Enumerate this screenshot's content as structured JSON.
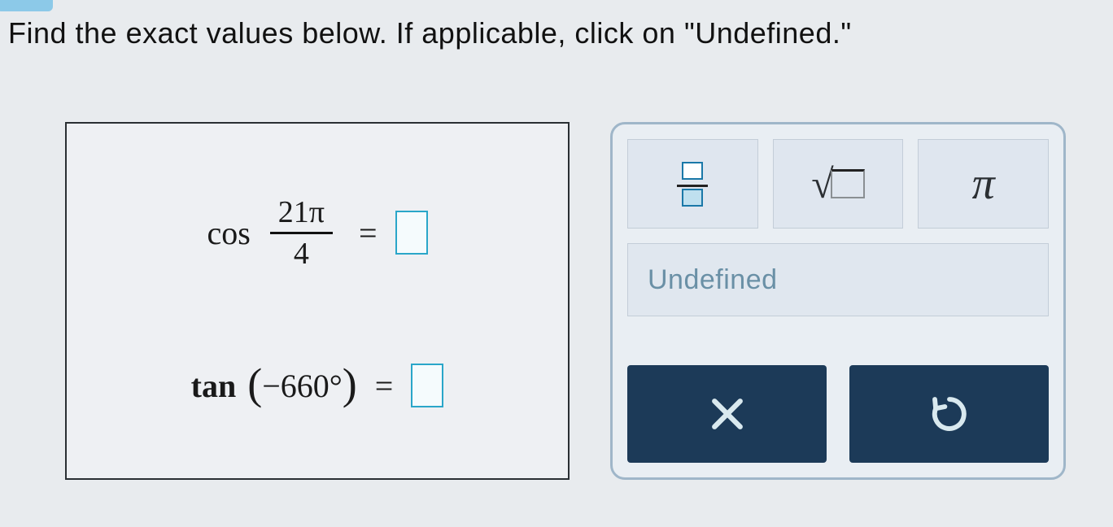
{
  "instruction": "Find the exact values below. If applicable, click on \"Undefined.\"",
  "problems": {
    "p1": {
      "fn": "cos",
      "numerator": "21π",
      "denominator": "4",
      "equals": "="
    },
    "p2": {
      "fn": "tan",
      "arg": "−660°",
      "equals": "="
    }
  },
  "tools": {
    "fraction_label": "fraction",
    "sqrt_label": "square root",
    "pi": "π",
    "undefined": "Undefined",
    "clear": "×",
    "reset": "↺"
  }
}
